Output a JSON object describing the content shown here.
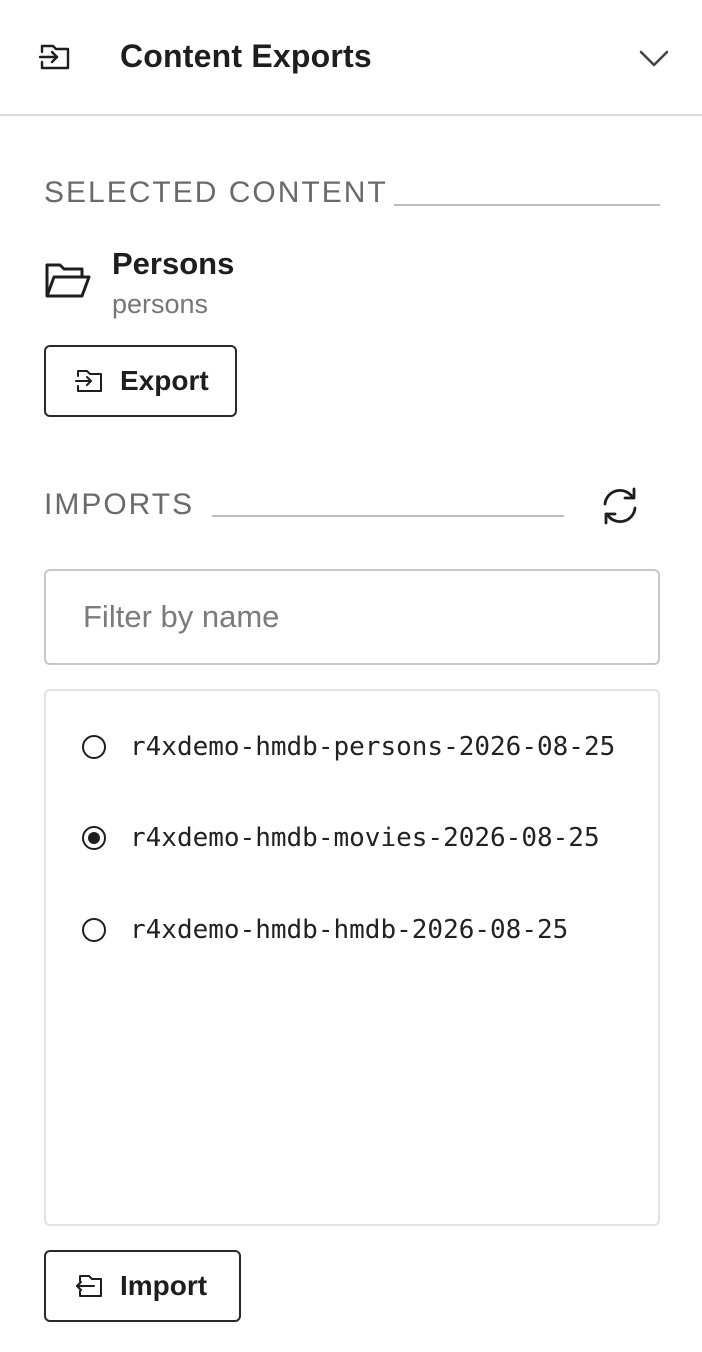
{
  "header": {
    "title": "Content Exports",
    "icon": "export-icon",
    "toggle_icon": "chevron-down-icon"
  },
  "selected_content": {
    "section_title": "SELECTED CONTENT",
    "icon": "folder-open-icon",
    "name": "Persons",
    "id": "persons",
    "export_button": "Export"
  },
  "imports": {
    "section_title": "IMPORTS",
    "refresh_icon": "refresh-icon",
    "filter_placeholder": "Filter by name",
    "filter_value": "",
    "items": [
      {
        "label": "r4xdemo-hmdb-persons-2026-08-25",
        "selected": false
      },
      {
        "label": "r4xdemo-hmdb-movies-2026-08-25",
        "selected": true
      },
      {
        "label": "r4xdemo-hmdb-hmdb-2026-08-25",
        "selected": false
      }
    ],
    "import_button": "Import"
  },
  "colors": {
    "text": "#1e1e1e",
    "muted": "#767676",
    "border": "#c7c7c7"
  }
}
